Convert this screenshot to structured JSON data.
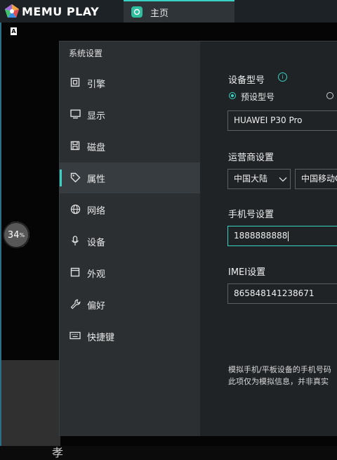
{
  "app": {
    "brand": "MEMU PLAY",
    "tab_home": "主页"
  },
  "screen": {
    "loading_percent": "34",
    "percent_sign": "%",
    "small_badge": "A",
    "bottom_char": "孝"
  },
  "settings": {
    "title": "系统设置",
    "nav": [
      {
        "label": "引擎",
        "icon": "chip-icon"
      },
      {
        "label": "显示",
        "icon": "monitor-icon"
      },
      {
        "label": "磁盘",
        "icon": "save-disk-icon"
      },
      {
        "label": "属性",
        "icon": "tag-icon",
        "active": true
      },
      {
        "label": "网络",
        "icon": "globe-icon"
      },
      {
        "label": "设备",
        "icon": "microphone-icon"
      },
      {
        "label": "外观",
        "icon": "window-icon"
      },
      {
        "label": "偏好",
        "icon": "wrench-icon"
      },
      {
        "label": "快捷键",
        "icon": "keyboard-icon"
      }
    ],
    "device_model": {
      "label": "设备型号",
      "info_icon": "i",
      "radio_preset": "预设型号",
      "model_value": "HUAWEI P30 Pro"
    },
    "carrier": {
      "label": "运营商设置",
      "region_value": "中国大陆",
      "operator_value": "中国移动CMCC"
    },
    "phone": {
      "label": "手机号设置",
      "value": "1888888888"
    },
    "imei": {
      "label": "IMEI设置",
      "value": "865848141238671"
    },
    "note_line1": "模拟手机/平板设备的手机号码",
    "note_line2": "此项仅为模拟信息，并非真实"
  },
  "colors": {
    "accent": "#39d1c3",
    "dialog_bg": "#2b2f32",
    "content_bg": "#1f2326"
  }
}
